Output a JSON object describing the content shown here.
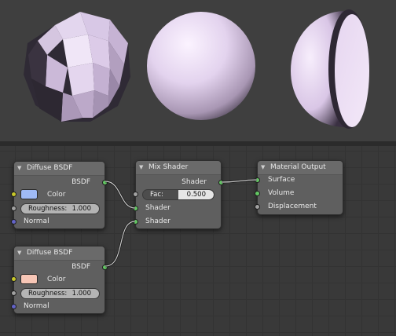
{
  "preview": {
    "objects": [
      "faceted-sphere",
      "smooth-sphere",
      "hemisphere"
    ]
  },
  "nodes": {
    "diffuse1": {
      "title": "Diffuse BSDF",
      "output_label": "BSDF",
      "color_label": "Color",
      "color_value": "#9fbaf6",
      "roughness_label": "Roughness:",
      "roughness_value": "1.000",
      "normal_label": "Normal"
    },
    "diffuse2": {
      "title": "Diffuse BSDF",
      "output_label": "BSDF",
      "color_label": "Color",
      "color_value": "#f7c6b6",
      "roughness_label": "Roughness:",
      "roughness_value": "1.000",
      "normal_label": "Normal"
    },
    "mix": {
      "title": "Mix Shader",
      "output_label": "Shader",
      "fac_label": "Fac:",
      "fac_value": "0.500",
      "fac_fraction": 0.5,
      "input1_label": "Shader",
      "input2_label": "Shader"
    },
    "output": {
      "title": "Material Output",
      "surface_label": "Surface",
      "volume_label": "Volume",
      "displacement_label": "Displacement"
    }
  }
}
